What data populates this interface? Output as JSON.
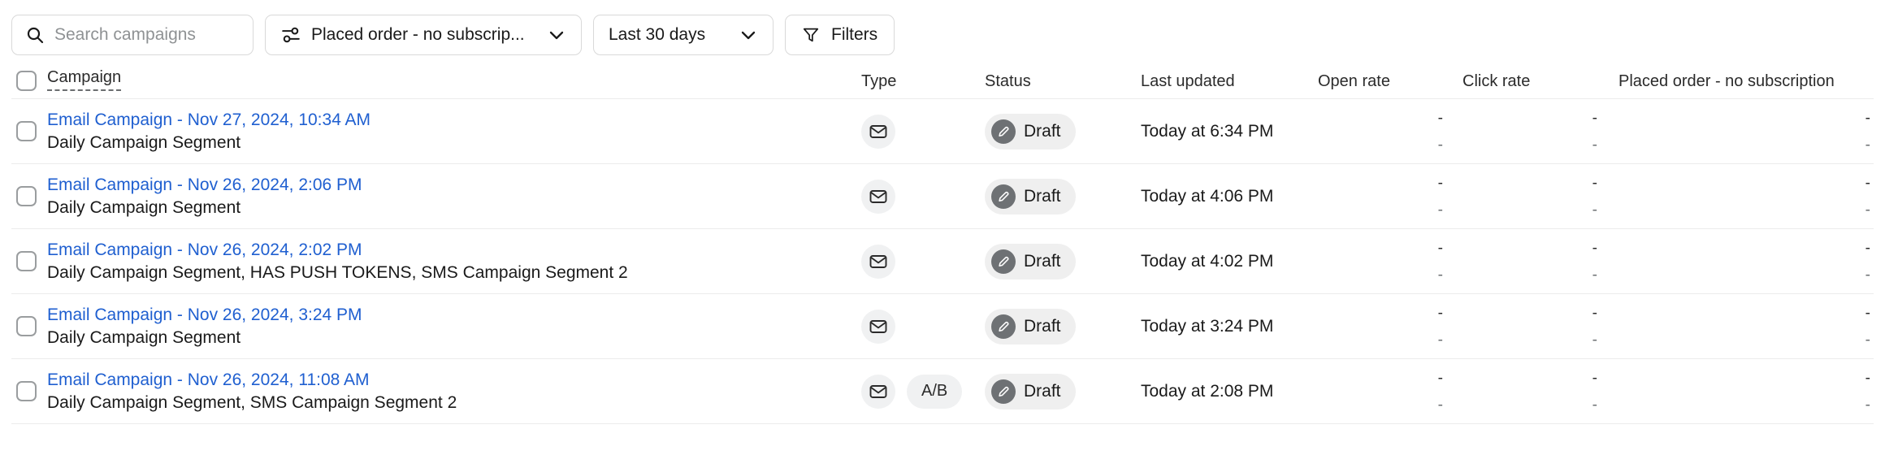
{
  "toolbar": {
    "search": {
      "placeholder": "Search campaigns",
      "value": "",
      "icon": "search-icon"
    },
    "metric_filter": {
      "label": "Placed order - no subscrip...",
      "icon": "sliders-icon",
      "chevron": "chevron-down-icon"
    },
    "date_filter": {
      "label": "Last 30 days",
      "chevron": "chevron-down-icon"
    },
    "filters_button": {
      "label": "Filters",
      "icon": "funnel-icon"
    }
  },
  "table": {
    "columns": {
      "campaign": "Campaign",
      "type": "Type",
      "status": "Status",
      "last_updated": "Last updated",
      "open_rate": "Open rate",
      "click_rate": "Click rate",
      "placed_order": "Placed order - no subscription"
    },
    "rows": [
      {
        "name": "Email Campaign - Nov 27, 2024, 10:34 AM",
        "segments": "Daily Campaign Segment",
        "type_icon": "email-icon",
        "ab_badge": "",
        "status": "Draft",
        "last_updated": "Today at 6:34 PM",
        "open_rate_primary": "-",
        "open_rate_secondary": "-",
        "click_rate_primary": "-",
        "click_rate_secondary": "-",
        "placed_order_primary": "-",
        "placed_order_secondary": "-"
      },
      {
        "name": "Email Campaign - Nov 26, 2024, 2:06 PM",
        "segments": "Daily Campaign Segment",
        "type_icon": "email-icon",
        "ab_badge": "",
        "status": "Draft",
        "last_updated": "Today at 4:06 PM",
        "open_rate_primary": "-",
        "open_rate_secondary": "-",
        "click_rate_primary": "-",
        "click_rate_secondary": "-",
        "placed_order_primary": "-",
        "placed_order_secondary": "-"
      },
      {
        "name": "Email Campaign - Nov 26, 2024, 2:02 PM",
        "segments": "Daily Campaign Segment, HAS PUSH TOKENS, SMS Campaign Segment 2",
        "type_icon": "email-icon",
        "ab_badge": "",
        "status": "Draft",
        "last_updated": "Today at 4:02 PM",
        "open_rate_primary": "-",
        "open_rate_secondary": "-",
        "click_rate_primary": "-",
        "click_rate_secondary": "-",
        "placed_order_primary": "-",
        "placed_order_secondary": "-"
      },
      {
        "name": "Email Campaign - Nov 26, 2024, 3:24 PM",
        "segments": "Daily Campaign Segment",
        "type_icon": "email-icon",
        "ab_badge": "",
        "status": "Draft",
        "last_updated": "Today at 3:24 PM",
        "open_rate_primary": "-",
        "open_rate_secondary": "-",
        "click_rate_primary": "-",
        "click_rate_secondary": "-",
        "placed_order_primary": "-",
        "placed_order_secondary": "-"
      },
      {
        "name": "Email Campaign - Nov 26, 2024, 11:08 AM",
        "segments": "Daily Campaign Segment, SMS Campaign Segment 2",
        "type_icon": "email-icon",
        "ab_badge": "A/B",
        "status": "Draft",
        "last_updated": "Today at 2:08 PM",
        "open_rate_primary": "-",
        "open_rate_secondary": "-",
        "click_rate_primary": "-",
        "click_rate_secondary": "-",
        "placed_order_primary": "-",
        "placed_order_secondary": "-"
      }
    ]
  },
  "colors": {
    "link": "#1f5fd0",
    "border": "#d9d9d9",
    "row_divider": "#ececec",
    "badge_bg": "#efefef",
    "badge_dot": "#6e7174",
    "placeholder": "#8f9294"
  }
}
